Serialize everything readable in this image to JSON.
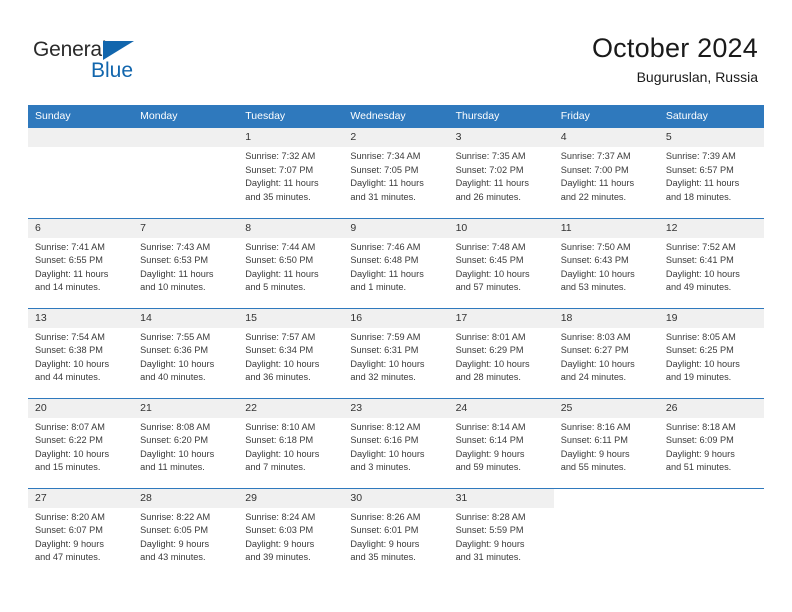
{
  "brand": {
    "name_top": "General",
    "name_bottom": "Blue",
    "triangle_icon": "triangle-icon",
    "color_primary": "#1266ad",
    "color_text": "#2b2b2b"
  },
  "header": {
    "title": "October 2024",
    "subtitle": "Buguruslan, Russia"
  },
  "theme": {
    "header_bar": "#2f79bd",
    "daynum_band": "#f0f0f0",
    "separator": "#2f79bd",
    "text": "#3a3a3a"
  },
  "calendar": {
    "weekday_headers": [
      "Sunday",
      "Monday",
      "Tuesday",
      "Wednesday",
      "Thursday",
      "Friday",
      "Saturday"
    ],
    "weeks": [
      [
        {
          "day": "",
          "lines": []
        },
        {
          "day": "",
          "lines": []
        },
        {
          "day": "1",
          "lines": [
            "Sunrise: 7:32 AM",
            "Sunset: 7:07 PM",
            "Daylight: 11 hours",
            "and 35 minutes."
          ]
        },
        {
          "day": "2",
          "lines": [
            "Sunrise: 7:34 AM",
            "Sunset: 7:05 PM",
            "Daylight: 11 hours",
            "and 31 minutes."
          ]
        },
        {
          "day": "3",
          "lines": [
            "Sunrise: 7:35 AM",
            "Sunset: 7:02 PM",
            "Daylight: 11 hours",
            "and 26 minutes."
          ]
        },
        {
          "day": "4",
          "lines": [
            "Sunrise: 7:37 AM",
            "Sunset: 7:00 PM",
            "Daylight: 11 hours",
            "and 22 minutes."
          ]
        },
        {
          "day": "5",
          "lines": [
            "Sunrise: 7:39 AM",
            "Sunset: 6:57 PM",
            "Daylight: 11 hours",
            "and 18 minutes."
          ]
        }
      ],
      [
        {
          "day": "6",
          "lines": [
            "Sunrise: 7:41 AM",
            "Sunset: 6:55 PM",
            "Daylight: 11 hours",
            "and 14 minutes."
          ]
        },
        {
          "day": "7",
          "lines": [
            "Sunrise: 7:43 AM",
            "Sunset: 6:53 PM",
            "Daylight: 11 hours",
            "and 10 minutes."
          ]
        },
        {
          "day": "8",
          "lines": [
            "Sunrise: 7:44 AM",
            "Sunset: 6:50 PM",
            "Daylight: 11 hours",
            "and 5 minutes."
          ]
        },
        {
          "day": "9",
          "lines": [
            "Sunrise: 7:46 AM",
            "Sunset: 6:48 PM",
            "Daylight: 11 hours",
            "and 1 minute."
          ]
        },
        {
          "day": "10",
          "lines": [
            "Sunrise: 7:48 AM",
            "Sunset: 6:45 PM",
            "Daylight: 10 hours",
            "and 57 minutes."
          ]
        },
        {
          "day": "11",
          "lines": [
            "Sunrise: 7:50 AM",
            "Sunset: 6:43 PM",
            "Daylight: 10 hours",
            "and 53 minutes."
          ]
        },
        {
          "day": "12",
          "lines": [
            "Sunrise: 7:52 AM",
            "Sunset: 6:41 PM",
            "Daylight: 10 hours",
            "and 49 minutes."
          ]
        }
      ],
      [
        {
          "day": "13",
          "lines": [
            "Sunrise: 7:54 AM",
            "Sunset: 6:38 PM",
            "Daylight: 10 hours",
            "and 44 minutes."
          ]
        },
        {
          "day": "14",
          "lines": [
            "Sunrise: 7:55 AM",
            "Sunset: 6:36 PM",
            "Daylight: 10 hours",
            "and 40 minutes."
          ]
        },
        {
          "day": "15",
          "lines": [
            "Sunrise: 7:57 AM",
            "Sunset: 6:34 PM",
            "Daylight: 10 hours",
            "and 36 minutes."
          ]
        },
        {
          "day": "16",
          "lines": [
            "Sunrise: 7:59 AM",
            "Sunset: 6:31 PM",
            "Daylight: 10 hours",
            "and 32 minutes."
          ]
        },
        {
          "day": "17",
          "lines": [
            "Sunrise: 8:01 AM",
            "Sunset: 6:29 PM",
            "Daylight: 10 hours",
            "and 28 minutes."
          ]
        },
        {
          "day": "18",
          "lines": [
            "Sunrise: 8:03 AM",
            "Sunset: 6:27 PM",
            "Daylight: 10 hours",
            "and 24 minutes."
          ]
        },
        {
          "day": "19",
          "lines": [
            "Sunrise: 8:05 AM",
            "Sunset: 6:25 PM",
            "Daylight: 10 hours",
            "and 19 minutes."
          ]
        }
      ],
      [
        {
          "day": "20",
          "lines": [
            "Sunrise: 8:07 AM",
            "Sunset: 6:22 PM",
            "Daylight: 10 hours",
            "and 15 minutes."
          ]
        },
        {
          "day": "21",
          "lines": [
            "Sunrise: 8:08 AM",
            "Sunset: 6:20 PM",
            "Daylight: 10 hours",
            "and 11 minutes."
          ]
        },
        {
          "day": "22",
          "lines": [
            "Sunrise: 8:10 AM",
            "Sunset: 6:18 PM",
            "Daylight: 10 hours",
            "and 7 minutes."
          ]
        },
        {
          "day": "23",
          "lines": [
            "Sunrise: 8:12 AM",
            "Sunset: 6:16 PM",
            "Daylight: 10 hours",
            "and 3 minutes."
          ]
        },
        {
          "day": "24",
          "lines": [
            "Sunrise: 8:14 AM",
            "Sunset: 6:14 PM",
            "Daylight: 9 hours",
            "and 59 minutes."
          ]
        },
        {
          "day": "25",
          "lines": [
            "Sunrise: 8:16 AM",
            "Sunset: 6:11 PM",
            "Daylight: 9 hours",
            "and 55 minutes."
          ]
        },
        {
          "day": "26",
          "lines": [
            "Sunrise: 8:18 AM",
            "Sunset: 6:09 PM",
            "Daylight: 9 hours",
            "and 51 minutes."
          ]
        }
      ],
      [
        {
          "day": "27",
          "lines": [
            "Sunrise: 8:20 AM",
            "Sunset: 6:07 PM",
            "Daylight: 9 hours",
            "and 47 minutes."
          ]
        },
        {
          "day": "28",
          "lines": [
            "Sunrise: 8:22 AM",
            "Sunset: 6:05 PM",
            "Daylight: 9 hours",
            "and 43 minutes."
          ]
        },
        {
          "day": "29",
          "lines": [
            "Sunrise: 8:24 AM",
            "Sunset: 6:03 PM",
            "Daylight: 9 hours",
            "and 39 minutes."
          ]
        },
        {
          "day": "30",
          "lines": [
            "Sunrise: 8:26 AM",
            "Sunset: 6:01 PM",
            "Daylight: 9 hours",
            "and 35 minutes."
          ]
        },
        {
          "day": "31",
          "lines": [
            "Sunrise: 8:28 AM",
            "Sunset: 5:59 PM",
            "Daylight: 9 hours",
            "and 31 minutes."
          ]
        },
        {
          "day": "",
          "lines": [],
          "blank": true
        },
        {
          "day": "",
          "lines": [],
          "blank": true
        }
      ]
    ]
  }
}
